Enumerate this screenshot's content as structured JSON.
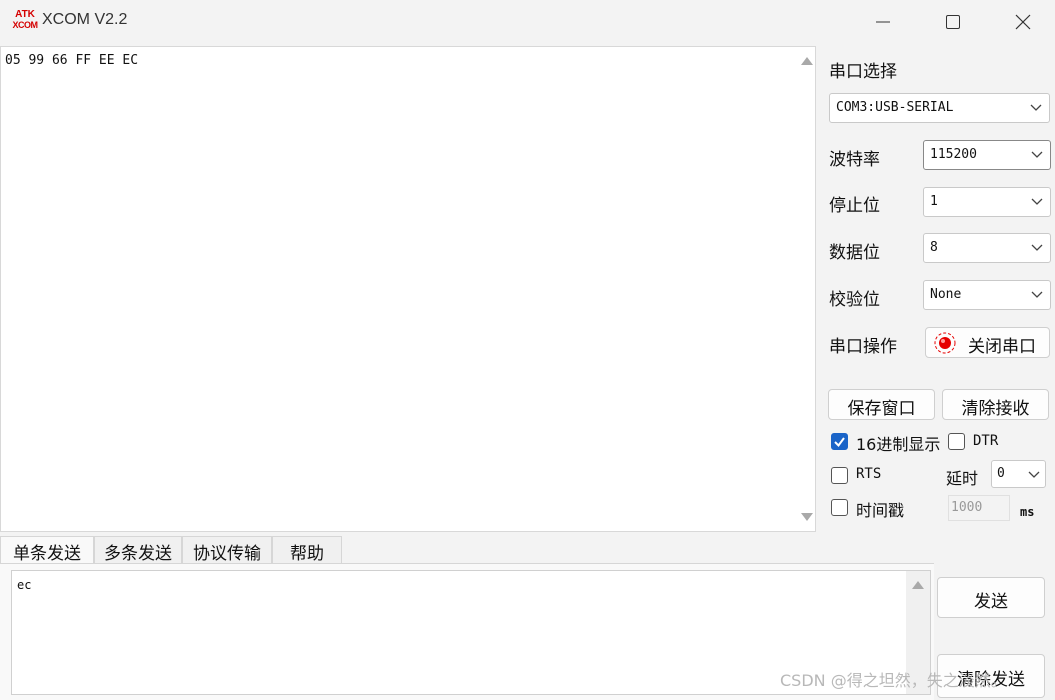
{
  "titlebar": {
    "logo_line1": "ATK",
    "logo_line2": "XCOM",
    "title": "XCOM V2.2"
  },
  "receive": {
    "text": "05 99 66 FF EE EC"
  },
  "settings": {
    "port_label": "串口选择",
    "port_value": "COM3:USB-SERIAL",
    "baud_label": "波特率",
    "baud_value": "115200",
    "stop_label": "停止位",
    "stop_value": "1",
    "data_label": "数据位",
    "data_value": "8",
    "parity_label": "校验位",
    "parity_value": "None",
    "op_label": "串口操作",
    "close_port_label": "关闭串口",
    "save_window_label": "保存窗口",
    "clear_receive_label": "清除接收",
    "hex_display_label": "16进制显示",
    "hex_display_checked": true,
    "dtr_label": "DTR",
    "rts_label": "RTS",
    "delay_label": "延时",
    "delay_value": "0",
    "timestamp_label": "时间戳",
    "timestamp_value": "1000",
    "ms_label": "ms"
  },
  "tabs": [
    {
      "label": "单条发送"
    },
    {
      "label": "多条发送"
    },
    {
      "label": "协议传输"
    },
    {
      "label": "帮助"
    }
  ],
  "send": {
    "text": "ec",
    "send_label": "发送",
    "clear_send_label": "清除发送"
  },
  "watermark": "CSDN @得之坦然，失之淡然。",
  "colors": {
    "accent": "#1a64c8",
    "logo_red": "#d40000",
    "status_red": "#e60000"
  }
}
